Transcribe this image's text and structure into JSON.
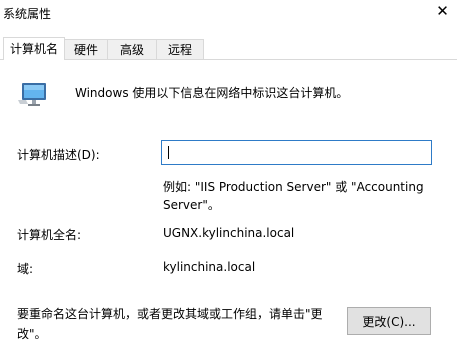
{
  "window": {
    "title": "系统属性",
    "close_glyph": "✕"
  },
  "tabs": [
    {
      "label": "计算机名",
      "active": true
    },
    {
      "label": "硬件",
      "active": false
    },
    {
      "label": "高级",
      "active": false
    },
    {
      "label": "远程",
      "active": false
    }
  ],
  "intro_text": "Windows 使用以下信息在网络中标识这台计算机。",
  "icons": {
    "computer": "computer-icon"
  },
  "description": {
    "label": "计算机描述(D):",
    "value": "",
    "example_line1": "例如: \"IIS Production Server\" 或 \"Accounting",
    "example_line2": "Server\"。"
  },
  "full_name": {
    "label": "计算机全名:",
    "value": "UGNX.kylinchina.local"
  },
  "domain": {
    "label": "域:",
    "value": "kylinchina.local"
  },
  "rename": {
    "text_line1": "要重命名这台计算机，或者更改其域或工作组，请单击\"更",
    "text_line2": "改\"。",
    "button_label": "更改(C)..."
  },
  "colors": {
    "focus_border": "#2e7bc7",
    "tab_inactive": "#f0f0f0",
    "button_bg": "#e1e1e1"
  }
}
